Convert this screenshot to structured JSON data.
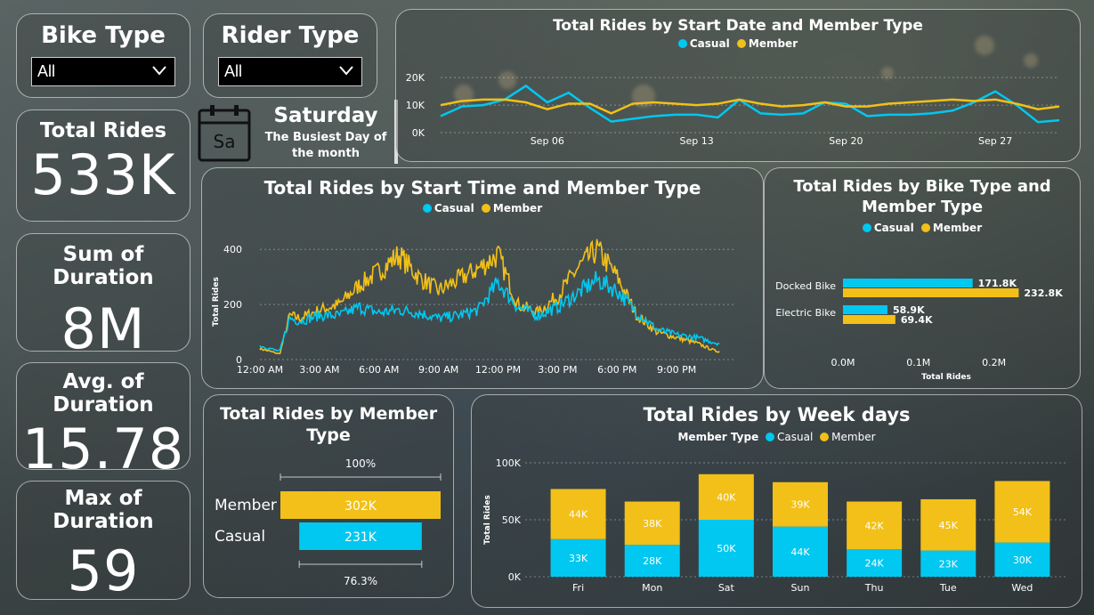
{
  "colors": {
    "casual": "#00c8f0",
    "member": "#f2c018"
  },
  "slicers": {
    "bike_type": {
      "label": "Bike Type",
      "value": "All"
    },
    "rider_type": {
      "label": "Rider Type",
      "value": "All"
    }
  },
  "kpis": {
    "total_rides": {
      "label": "Total Rides",
      "value": "533K"
    },
    "sum_duration": {
      "label": "Sum of Duration",
      "value": "8M"
    },
    "avg_duration": {
      "label": "Avg. of Duration",
      "value": "15.78"
    },
    "max_duration": {
      "label": "Max of Duration",
      "value": "59"
    }
  },
  "busiest_day": {
    "icon_text": "Sa",
    "day": "Saturday",
    "caption_line1": "The Busiest Day of",
    "caption_line2": "the month"
  },
  "legend": {
    "casual": "Casual",
    "member": "Member",
    "member_type": "Member Type"
  },
  "chart_data": [
    {
      "id": "by_start_date",
      "type": "line",
      "title": "Total Rides by Start Date and Member Type",
      "x_ticks": [
        "Sep 06",
        "Sep 13",
        "Sep 20",
        "Sep 27"
      ],
      "y_ticks": [
        "0K",
        "10K",
        "20K"
      ],
      "ylim": [
        0,
        22000
      ],
      "x_days": [
        1,
        2,
        3,
        4,
        5,
        6,
        7,
        8,
        9,
        10,
        11,
        12,
        13,
        14,
        15,
        16,
        17,
        18,
        19,
        20,
        21,
        22,
        23,
        24,
        25,
        26,
        27,
        28,
        29,
        30
      ],
      "series": [
        {
          "name": "Casual",
          "values": [
            6000,
            9500,
            10000,
            12000,
            17000,
            11000,
            14500,
            9000,
            4000,
            5000,
            6000,
            6500,
            6500,
            5500,
            12000,
            7000,
            6500,
            7000,
            11000,
            10500,
            6000,
            6500,
            6500,
            7000,
            8000,
            11000,
            15000,
            10000,
            3800,
            4500
          ]
        },
        {
          "name": "Member",
          "values": [
            10000,
            11500,
            12000,
            12000,
            11000,
            8500,
            10500,
            10500,
            7000,
            10500,
            11000,
            10500,
            10000,
            10500,
            12000,
            10500,
            9500,
            10000,
            11000,
            9500,
            9500,
            10500,
            11000,
            11500,
            12000,
            11500,
            12000,
            10500,
            8500,
            9500
          ]
        }
      ],
      "grid": true,
      "legend_position": "top"
    },
    {
      "id": "by_start_time",
      "type": "line",
      "title": "Total Rides by Start Time and Member Type",
      "ylabel": "Total Rides",
      "x_ticks": [
        "12:00 AM",
        "3:00 AM",
        "6:00 AM",
        "9:00 AM",
        "12:00 PM",
        "3:00 PM",
        "6:00 PM",
        "9:00 PM"
      ],
      "y_ticks": [
        "0",
        "200",
        "400"
      ],
      "ylim": [
        0,
        420
      ],
      "x_hours": [
        0,
        1,
        1.5,
        2,
        3,
        4,
        5,
        6,
        7,
        8,
        9,
        10,
        11,
        12,
        13,
        14,
        15,
        16,
        17,
        18,
        19,
        20,
        21,
        22,
        23
      ],
      "series": [
        {
          "name": "Casual",
          "values": [
            50,
            30,
            150,
            140,
            160,
            160,
            190,
            170,
            180,
            170,
            150,
            160,
            180,
            280,
            190,
            160,
            190,
            240,
            290,
            250,
            170,
            110,
            90,
            80,
            60
          ]
        },
        {
          "name": "Member",
          "values": [
            40,
            20,
            160,
            150,
            180,
            200,
            270,
            320,
            380,
            300,
            250,
            290,
            330,
            380,
            200,
            170,
            230,
            330,
            400,
            300,
            160,
            100,
            80,
            60,
            30
          ]
        }
      ],
      "grid": true,
      "legend_position": "top"
    },
    {
      "id": "by_bike_type",
      "type": "bar",
      "orientation": "horizontal",
      "title_line1": "Total Rides by Bike Type and",
      "title_line2": "Member Type",
      "xlabel": "Total Rides",
      "categories": [
        "Docked Bike",
        "Electric Bike"
      ],
      "x_ticks": [
        "0.0M",
        "0.1M",
        "0.2M"
      ],
      "xlim": [
        0,
        0.25
      ],
      "series": [
        {
          "name": "Casual",
          "values": [
            171.8,
            58.9
          ],
          "labels": [
            "171.8K",
            "58.9K"
          ]
        },
        {
          "name": "Member",
          "values": [
            232.8,
            69.4
          ],
          "labels": [
            "232.8K",
            "69.4K"
          ]
        }
      ],
      "legend_position": "top"
    },
    {
      "id": "by_member_type",
      "type": "bar",
      "orientation": "horizontal",
      "title_line1": "Total Rides by Member",
      "title_line2": "Type",
      "categories": [
        "Member",
        "Casual"
      ],
      "values": [
        302,
        231
      ],
      "labels": [
        "302K",
        "231K"
      ],
      "top_pct": "100%",
      "bottom_pct": "76.3%"
    },
    {
      "id": "by_week_days",
      "type": "bar",
      "stacked": true,
      "title": "Total Rides by Week days",
      "ylabel": "Total Rides",
      "categories": [
        "Fri",
        "Mon",
        "Sat",
        "Sun",
        "Thu",
        "Tue",
        "Wed"
      ],
      "y_ticks": [
        "0K",
        "50K",
        "100K"
      ],
      "ylim": [
        0,
        100
      ],
      "series": [
        {
          "name": "Casual",
          "values": [
            33,
            28,
            50,
            44,
            24,
            23,
            30
          ],
          "labels": [
            "33K",
            "28K",
            "50K",
            "44K",
            "24K",
            "23K",
            "30K"
          ]
        },
        {
          "name": "Member",
          "values": [
            44,
            38,
            40,
            39,
            42,
            45,
            54
          ],
          "labels": [
            "44K",
            "38K",
            "40K",
            "39K",
            "42K",
            "45K",
            "54K"
          ]
        }
      ],
      "grid": true,
      "legend_position": "top"
    }
  ]
}
